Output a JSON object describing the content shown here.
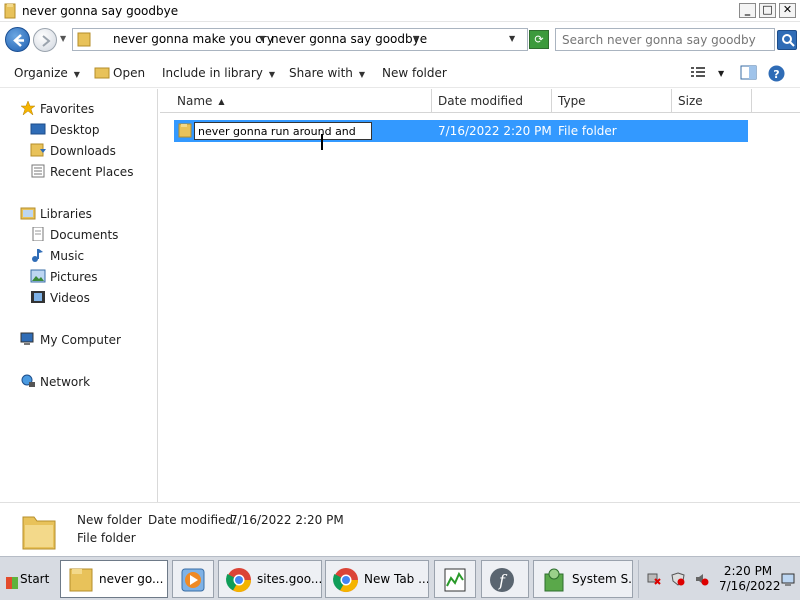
{
  "window": {
    "title": "never gonna say goodbye",
    "minimize": "_",
    "maximize": "□",
    "close": "✕"
  },
  "address": {
    "crumbs": [
      "never gonna make you cry",
      "never gonna say goodbye"
    ],
    "search_placeholder": "Search never gonna say goodbye"
  },
  "toolbar": {
    "organize": "Organize",
    "open": "Open",
    "include_in_library": "Include in library",
    "share_with": "Share with",
    "new_folder": "New folder"
  },
  "nav": {
    "favorites": "Favorites",
    "desktop": "Desktop",
    "downloads": "Downloads",
    "recent_places": "Recent Places",
    "libraries": "Libraries",
    "documents": "Documents",
    "music": "Music",
    "pictures": "Pictures",
    "videos": "Videos",
    "my_computer": "My Computer",
    "network": "Network"
  },
  "columns": {
    "name": "Name",
    "date_modified": "Date modified",
    "type": "Type",
    "size": "Size"
  },
  "files": [
    {
      "name_editing": "never gonna run around and",
      "date_modified": "7/16/2022 2:20 PM",
      "type": "File folder"
    }
  ],
  "details": {
    "name": "New folder",
    "date_label": "Date modified:",
    "date_value": "7/16/2022 2:20 PM",
    "type": "File folder"
  },
  "taskbar": {
    "start": "Start",
    "items": [
      {
        "label": "never go...",
        "icon": "folder-icon"
      },
      {
        "label": "",
        "icon": "media-player-icon"
      },
      {
        "label": "sites.goo...",
        "icon": "chrome-icon"
      },
      {
        "label": "New Tab ...",
        "icon": "chrome-icon"
      },
      {
        "label": "",
        "icon": "task-manager-icon"
      },
      {
        "label": "",
        "icon": "flash-icon"
      },
      {
        "label": "System S...",
        "icon": "system-scanner-icon"
      }
    ],
    "clock_time": "2:20 PM",
    "clock_date": "7/16/2022"
  },
  "colors": {
    "selection": "#3399ff",
    "accent": "#2f6cb6",
    "folder": "#e8c25a"
  }
}
